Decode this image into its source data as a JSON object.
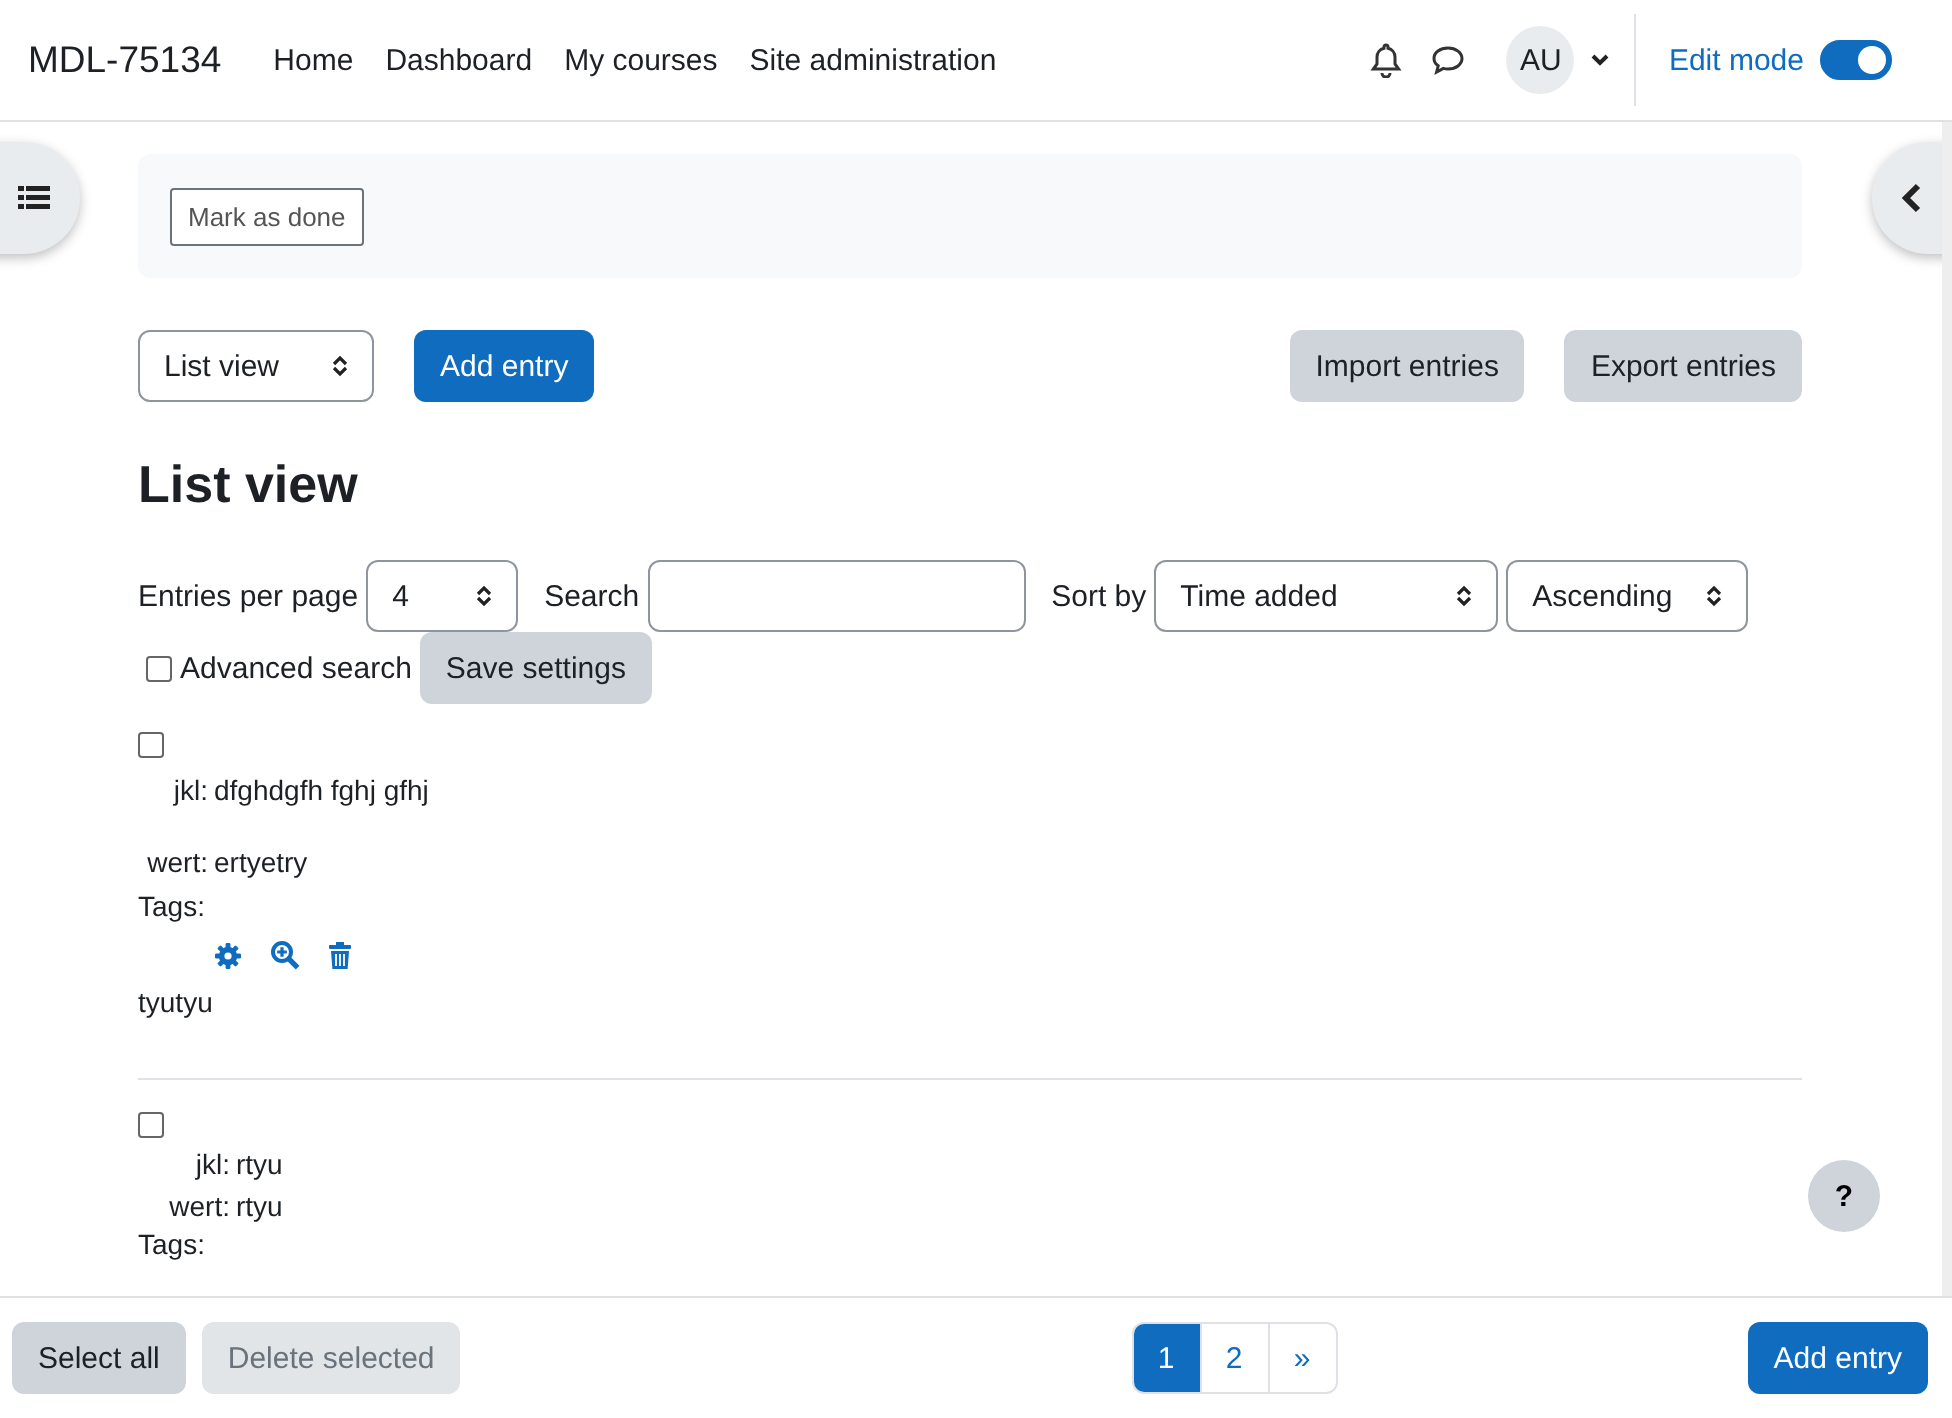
{
  "site_name": "MDL-75134",
  "nav": [
    {
      "label": "Home"
    },
    {
      "label": "Dashboard"
    },
    {
      "label": "My courses"
    },
    {
      "label": "Site administration"
    }
  ],
  "user": {
    "initials": "AU"
  },
  "edit_mode": {
    "label": "Edit mode",
    "on": true
  },
  "completion": {
    "button": "Mark as done"
  },
  "toolbar": {
    "view_select": "List view",
    "add": "Add entry",
    "import": "Import entries",
    "export": "Export entries"
  },
  "heading": "List view",
  "settings": {
    "per_page_label": "Entries per page",
    "per_page": "4",
    "search_label": "Search",
    "sort_label": "Sort by",
    "sort_field": "Time added",
    "sort_order": "Ascending",
    "advanced": {
      "label": "Advanced search",
      "checked": false
    },
    "save": "Save settings"
  },
  "entries": [
    {
      "checked": false,
      "fields": [
        {
          "name": "jkl:",
          "value": "dfghdgfh fghj gfhj"
        },
        {
          "name": "wert:",
          "value": "ertyetry"
        }
      ],
      "tags_label": "Tags:",
      "actions": [
        {
          "kind": "edit"
        },
        {
          "kind": "view"
        },
        {
          "kind": "delete"
        }
      ],
      "note": "tyutyu"
    },
    {
      "checked": false,
      "fields": [
        {
          "name": "jkl:",
          "value": "rtyu"
        },
        {
          "name": "wert:",
          "value": "rtyu"
        }
      ],
      "tags_label": "Tags:"
    }
  ],
  "help": "?",
  "footer": {
    "select_all": "Select all",
    "delete_selected": {
      "label": "Delete selected",
      "disabled": true
    },
    "pages": [
      {
        "label": "1",
        "selected": true
      },
      {
        "label": "2",
        "selected": false
      }
    ],
    "next": "»",
    "add": "Add entry"
  }
}
